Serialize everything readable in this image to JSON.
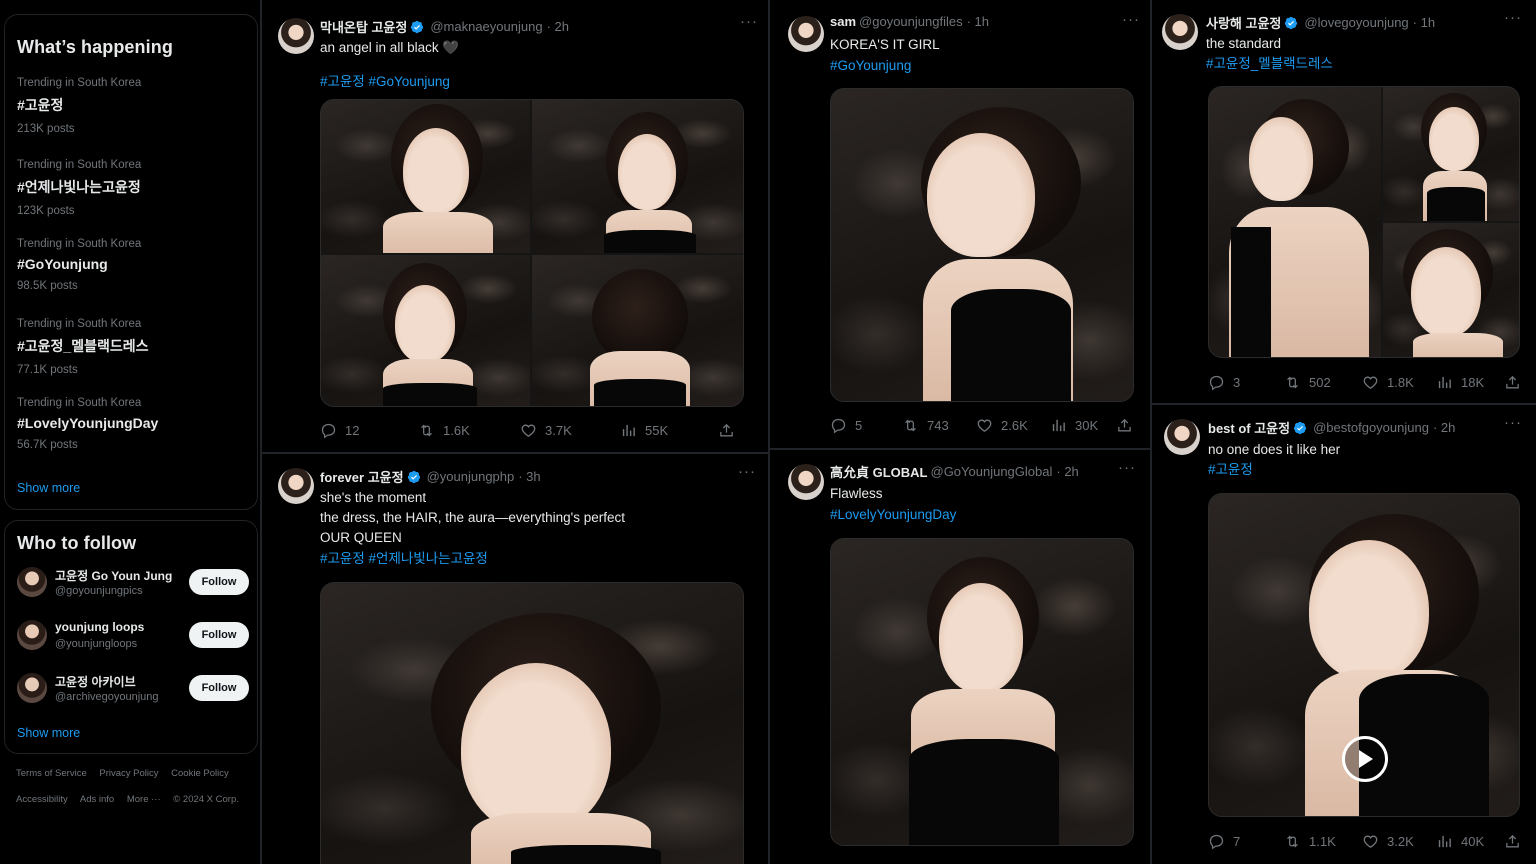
{
  "sidebar": {
    "whats_happening_title": "What’s happening",
    "trends": [
      {
        "context": "Trending in South Korea",
        "tag": "#고윤정",
        "count": "213K posts"
      },
      {
        "context": "Trending in South Korea",
        "tag": "#언제나빛나는고윤정",
        "count": "123K posts"
      },
      {
        "context": "Trending in South Korea",
        "tag": "#GoYounjung",
        "count": "98.5K posts"
      },
      {
        "context": "Trending in South Korea",
        "tag": "#고윤정_멜블랙드레스",
        "count": "77.1K posts"
      },
      {
        "context": "Trending in South Korea",
        "tag": "#LovelyYounjungDay",
        "count": "56.7K posts"
      }
    ],
    "trends_show_more": "Show more",
    "who_to_follow_title": "Who to follow",
    "follow": [
      {
        "name": "고윤정 Go Youn Jung",
        "handle": "@goyounjungpics",
        "button": "Follow"
      },
      {
        "name": "younjung loops",
        "handle": "@younjungloops",
        "button": "Follow"
      },
      {
        "name": "고윤정 아카이브",
        "handle": "@archivegoyounjung",
        "button": "Follow"
      }
    ],
    "follow_show_more": "Show more",
    "footer_row1": [
      "Terms of Service",
      "Privacy Policy",
      "Cookie Policy"
    ],
    "footer_row2": [
      "Accessibility",
      "Ads info",
      "More ···",
      "© 2024 X Corp."
    ]
  },
  "posts": {
    "p1": {
      "name": "막내온탑 고윤정",
      "handle": "@maknaeyounjung",
      "time": "· 2h",
      "line1": "an angel in all black 🖤",
      "tags": "#고윤정 #GoYounjung",
      "replies": "12",
      "reposts": "1.6K",
      "likes": "3.7K",
      "views": "55K"
    },
    "p2": {
      "name": "forever 고윤정",
      "handle": "@younjungphp",
      "time": "· 3h",
      "line1": "she's the moment",
      "line2": "the dress, the HAIR, the aura—everything's perfect",
      "line3": "OUR QUEEN",
      "tags": "#고윤정 #언제나빛나는고윤정"
    },
    "p3": {
      "name": "sam",
      "handle": "@goyounjungfiles",
      "time": "· 1h",
      "line1": "KOREA'S IT GIRL",
      "tags": "#GoYounjung",
      "replies": "5",
      "reposts": "743",
      "likes": "2.6K",
      "views": "30K"
    },
    "p4": {
      "name": "高允貞 GLOBAL",
      "handle": "@GoYounjungGlobal",
      "time": "· 2h",
      "line1": "Flawless",
      "tags": "#LovelyYounjungDay"
    },
    "p5": {
      "name": "사랑해 고윤정",
      "handle": "@lovegoyounjung",
      "time": "· 1h",
      "line1": "the standard",
      "tags": "#고윤정_멜블랙드레스",
      "replies": "3",
      "reposts": "502",
      "likes": "1.8K",
      "views": "18K"
    },
    "p6": {
      "name": "best of 고윤정",
      "handle": "@bestofgoyounjung",
      "time": "· 2h",
      "line1": "no one does it like her",
      "tags": "#고윤정",
      "replies": "7",
      "reposts": "1.1K",
      "likes": "3.2K",
      "views": "40K"
    },
    "more_label": "···"
  },
  "colors": {
    "accent": "#1d9bf0",
    "muted": "#71767b",
    "text": "#e7e9ea",
    "background": "#000000"
  }
}
